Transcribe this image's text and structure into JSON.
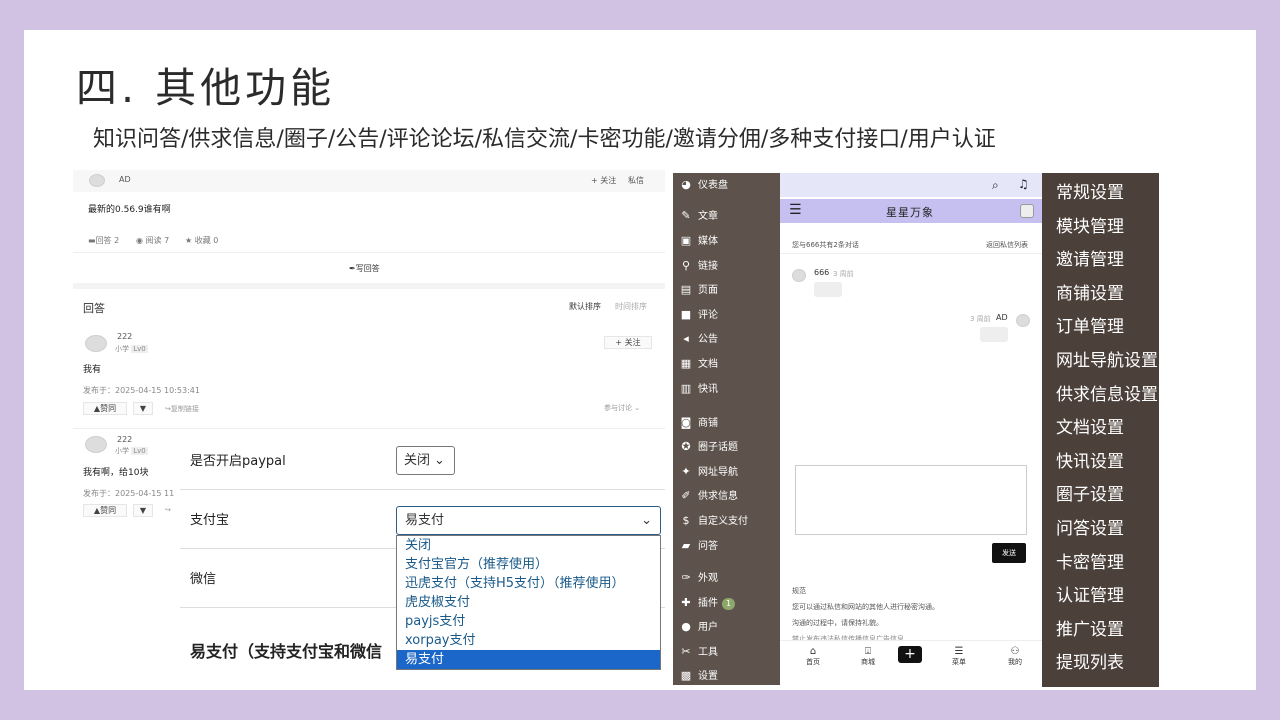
{
  "title": "四. 其他功能",
  "subtitle": "知识问答/供求信息/圈子/公告/评论论坛/私信交流/卡密功能/邀请分佣/多种支付接口/用户认证",
  "qa": {
    "author": "AD",
    "follow": "+ 关注",
    "message": "私信",
    "question": "最新的0.56.9谁有啊",
    "stats": {
      "answers": "回答 2",
      "views": "阅读 7",
      "favs": "收藏 0"
    },
    "write": "写回答",
    "answers_title": "回答",
    "sort_default": "默认排序",
    "sort_time": "时间排序",
    "a1": {
      "user": "222",
      "level_prefix": "小学",
      "level": "Lv0",
      "follow": "+ 关注",
      "text": "我有",
      "time": "发布于：2025-04-15 10:53:41",
      "like": "赞同",
      "link": "复制链接",
      "reply": "参与讨论"
    },
    "a2": {
      "user": "222",
      "level_prefix": "小学",
      "level": "Lv0",
      "text": "我有啊，给10块",
      "time": "发布于：2025-04-15 11"
    }
  },
  "pay": {
    "paypal_label": "是否开启paypal",
    "paypal_value": "关闭",
    "alipay_label": "支付宝",
    "alipay_value": "易支付",
    "wechat_label": "微信",
    "section_title": "易支付（支持支付宝和微信",
    "options": [
      "关闭",
      "支付宝官方（推荐使用）",
      "迅虎支付（支持H5支付）（推荐使用）",
      "虎皮椒支付",
      "payjs支付",
      "xorpay支付",
      "易支付"
    ],
    "selected_index": 6
  },
  "wp_menu": [
    {
      "icon": "◕",
      "label": "仪表盘"
    },
    {
      "icon": "✎",
      "label": "文章"
    },
    {
      "icon": "▣",
      "label": "媒体"
    },
    {
      "icon": "⚲",
      "label": "链接"
    },
    {
      "icon": "▤",
      "label": "页面"
    },
    {
      "icon": "■",
      "label": "评论"
    },
    {
      "icon": "◂",
      "label": "公告"
    },
    {
      "icon": "▦",
      "label": "文档"
    },
    {
      "icon": "▥",
      "label": "快讯"
    },
    {
      "icon": "◙",
      "label": "商铺"
    },
    {
      "icon": "✪",
      "label": "圈子话题"
    },
    {
      "icon": "✦",
      "label": "网址导航"
    },
    {
      "icon": "✐",
      "label": "供求信息"
    },
    {
      "icon": "$",
      "label": "自定义支付"
    },
    {
      "icon": "▰",
      "label": "问答"
    },
    {
      "icon": "✑",
      "label": "外观"
    },
    {
      "icon": "✚",
      "label": "插件",
      "badge": "1"
    },
    {
      "icon": "●",
      "label": "用户"
    },
    {
      "icon": "✂",
      "label": "工具"
    },
    {
      "icon": "▩",
      "label": "设置"
    }
  ],
  "mobile": {
    "site_title": "星星万象",
    "conv_info": "您与666共有2条对话",
    "back_list": "返回私信列表",
    "msg1_user": "666",
    "msg1_time": "3 周前",
    "msg2_user": "AD",
    "msg2_time": "3 周前",
    "send": "发送",
    "rules_title": "规范",
    "rules_1": "您可以通过私信和网站的其他人进行秘密沟通。",
    "rules_2": "沟通的过程中，请保持礼貌。",
    "rules_3": "禁止发布违法私信传播信息广告信息",
    "nav": [
      {
        "icon": "⌂",
        "label": "首页"
      },
      {
        "icon": "⍗",
        "label": "商城"
      },
      {
        "icon": "+",
        "label": ""
      },
      {
        "icon": "☰",
        "label": "菜单"
      },
      {
        "icon": "⚇",
        "label": "我的"
      }
    ]
  },
  "settings_menu": [
    "常规设置",
    "模块管理",
    "邀请管理",
    "商铺设置",
    "订单管理",
    "网址导航设置",
    "供求信息设置",
    "文档设置",
    "快讯设置",
    "圈子设置",
    "问答设置",
    "卡密管理",
    "认证管理",
    "推广设置",
    "提现列表"
  ]
}
